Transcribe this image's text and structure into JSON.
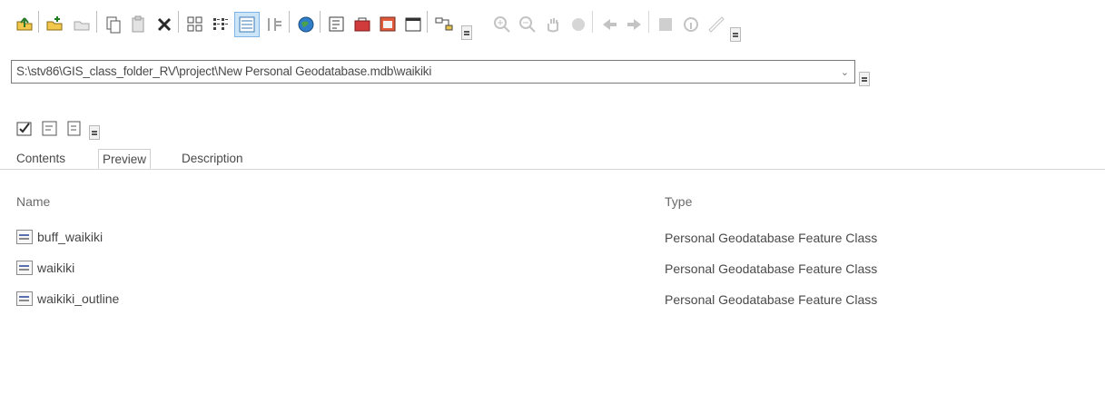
{
  "toolbar": {
    "icons": [
      "up-one-level-icon",
      "connect-folder-icon",
      "disconnect-folder-icon",
      "copy-icon",
      "paste-icon",
      "delete-icon",
      "large-icons-icon",
      "list-icon",
      "details-icon",
      "thumbnails-icon",
      "launch-arcmap-icon",
      "catalog-tree-icon",
      "arctoolbox-icon",
      "search-window-icon",
      "python-window-icon",
      "model-builder-icon",
      "zoom-in-icon",
      "zoom-out-icon",
      "pan-icon",
      "full-extent-icon",
      "back-icon",
      "forward-icon",
      "select-icon",
      "identify-icon",
      "measure-icon"
    ]
  },
  "location": {
    "path": "S:\\stv86\\GIS_class_folder_RV\\project\\New Personal Geodatabase.mdb\\waikiki"
  },
  "tabs": [
    {
      "label": "Contents",
      "active": true
    },
    {
      "label": "Preview",
      "active": false
    },
    {
      "label": "Description",
      "active": false
    }
  ],
  "list": {
    "columns": [
      "Name",
      "Type"
    ],
    "rows": [
      {
        "name": "buff_waikiki",
        "type": "Personal Geodatabase Feature Class"
      },
      {
        "name": "waikiki",
        "type": "Personal Geodatabase Feature Class"
      },
      {
        "name": "waikiki_outline",
        "type": "Personal Geodatabase Feature Class"
      }
    ]
  }
}
